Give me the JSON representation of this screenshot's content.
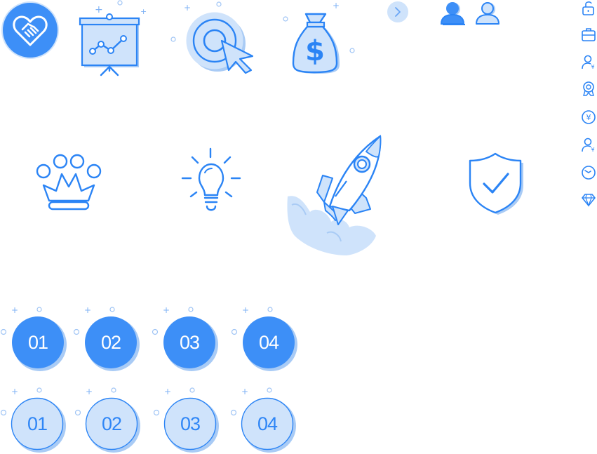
{
  "colors": {
    "primary": "#3d8ff7",
    "light": "#cfe3fb",
    "outline": "#2b84f5",
    "shadow": "#a9cbf5"
  },
  "top_row_icons": [
    "handshake-icon",
    "presentation-chart-icon",
    "target-click-icon",
    "money-bag-icon",
    "chevron-right-icon",
    "user-icon",
    "user-outline-icon"
  ],
  "middle_row_icons": [
    "crown-icon",
    "lightbulb-icon",
    "rocket-icon",
    "shield-check-icon"
  ],
  "side_icons": [
    "unlock-icon",
    "briefcase-icon",
    "user-yen-icon",
    "medal-icon",
    "yen-coin-icon",
    "user-yen-icon",
    "clock-icon",
    "diamond-icon"
  ],
  "badges_solid": [
    "01",
    "02",
    "03",
    "04"
  ],
  "badges_light": [
    "01",
    "02",
    "03",
    "04"
  ]
}
